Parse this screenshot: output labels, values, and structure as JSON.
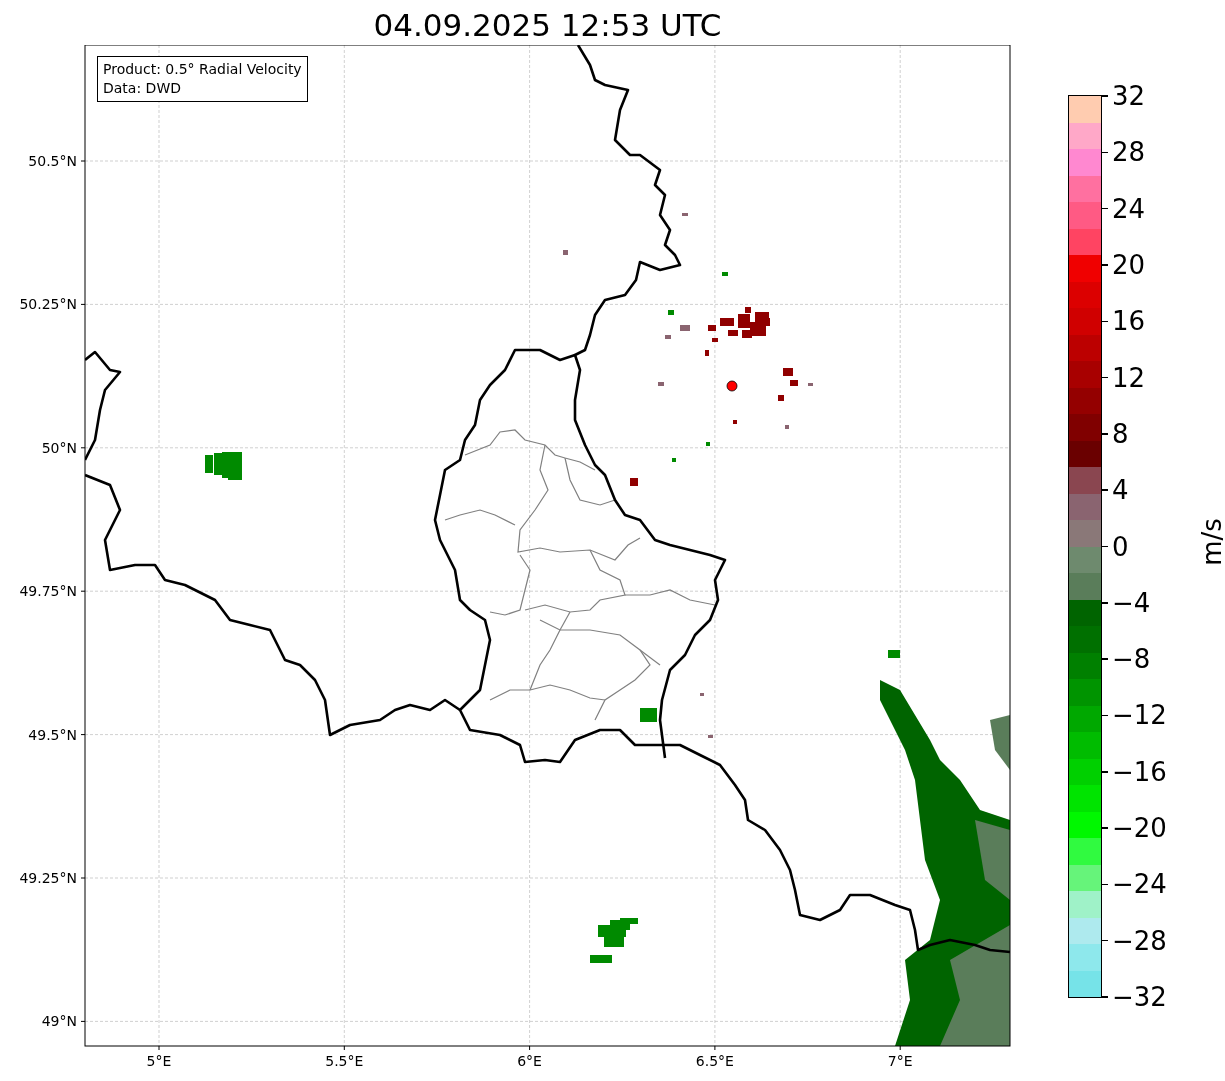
{
  "title": "04.09.2025 12:53 UTC",
  "info_box": [
    "Product: 0.5° Radial Velocity",
    "Data: DWD"
  ],
  "map": {
    "x_ticks": [
      "5°E",
      "5.5°E",
      "6°E",
      "6.5°E",
      "7°E"
    ],
    "y_ticks": [
      "50.5°N",
      "50.25°N",
      "50°N",
      "49.75°N",
      "49.5°N",
      "49.25°N",
      "49°N"
    ]
  },
  "colorbar": {
    "label": "m/s",
    "ticks": [
      "32",
      "28",
      "24",
      "20",
      "16",
      "12",
      "8",
      "4",
      "0",
      "−4",
      "−8",
      "−12",
      "−16",
      "−20",
      "−24",
      "−28",
      "−32"
    ],
    "bins": [
      {
        "color": "#ffccb0"
      },
      {
        "color": "#ffa8c8"
      },
      {
        "color": "#ff88d0"
      },
      {
        "color": "#ff70a0"
      },
      {
        "color": "#ff5a84"
      },
      {
        "color": "#ff4462"
      },
      {
        "color": "#f00000"
      },
      {
        "color": "#dc0000"
      },
      {
        "color": "#d00000"
      },
      {
        "color": "#bc0000"
      },
      {
        "color": "#a80000"
      },
      {
        "color": "#940000"
      },
      {
        "color": "#800000"
      },
      {
        "color": "#6a0000"
      },
      {
        "color": "#8a4650"
      },
      {
        "color": "#8a6470"
      },
      {
        "color": "#8a7878"
      },
      {
        "color": "#6e8a6e"
      },
      {
        "color": "#5a7d5a"
      },
      {
        "color": "#006400"
      },
      {
        "color": "#007000"
      },
      {
        "color": "#008000"
      },
      {
        "color": "#009400"
      },
      {
        "color": "#00a800"
      },
      {
        "color": "#00bc00"
      },
      {
        "color": "#00d000"
      },
      {
        "color": "#00e400"
      },
      {
        "color": "#00f800"
      },
      {
        "color": "#30fa40"
      },
      {
        "color": "#66f47a"
      },
      {
        "color": "#9ff2c8"
      },
      {
        "color": "#aeeaee"
      },
      {
        "color": "#8ee8ec"
      },
      {
        "color": "#76e3e8"
      }
    ]
  }
}
